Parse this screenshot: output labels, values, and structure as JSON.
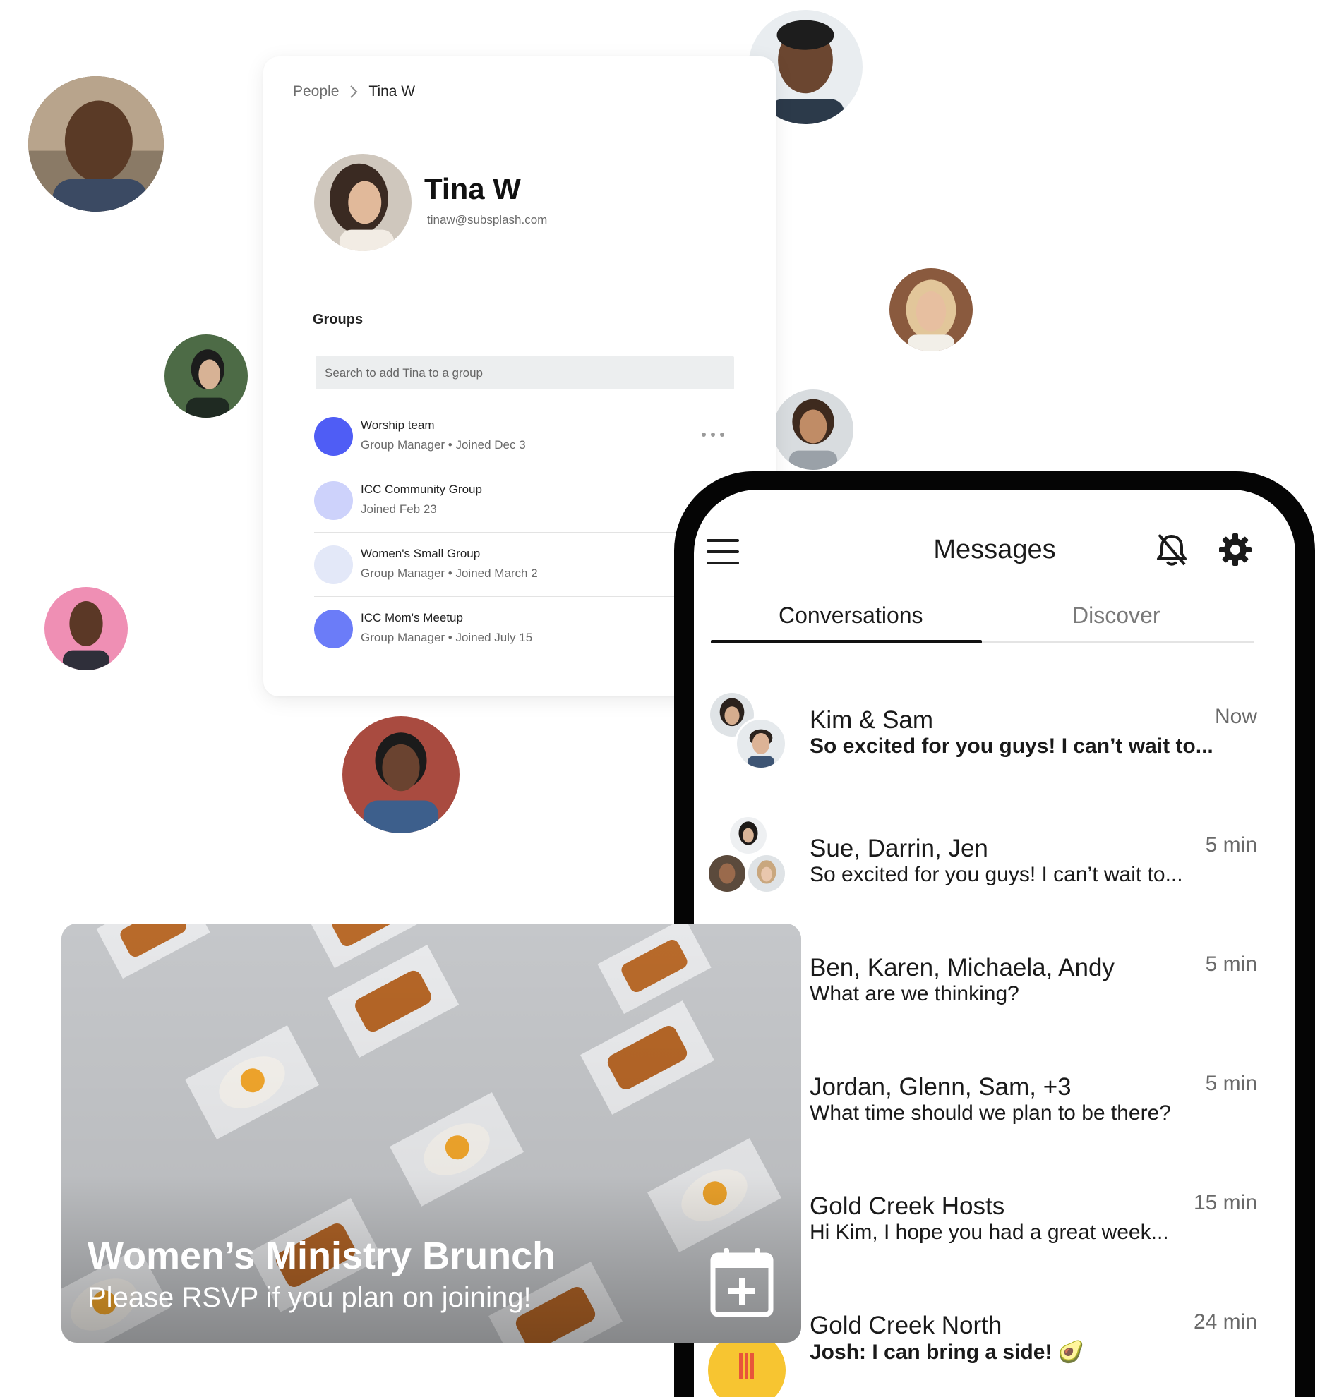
{
  "profile": {
    "breadcrumb": {
      "root": "People",
      "current": "Tina W"
    },
    "name": "Tina W",
    "email": "tinaw@subsplash.com",
    "groups_heading": "Groups",
    "search_placeholder": "Search to add Tina to a group",
    "groups": [
      {
        "name": "Worship team",
        "meta": "Group Manager • Joined Dec 3",
        "color": "#4f5df5"
      },
      {
        "name": "ICC Community Group",
        "meta": "Joined Feb 23",
        "color": "#cdd2fb"
      },
      {
        "name": "Women's Small Group",
        "meta": "Group Manager • Joined March 2",
        "color": "#e3e8f8"
      },
      {
        "name": "ICC Mom's Meetup",
        "meta": "Group Manager • Joined July 15",
        "color": "#6b7cf8"
      }
    ]
  },
  "messages": {
    "title": "Messages",
    "tabs": {
      "active": "Conversations",
      "inactive": "Discover"
    },
    "conversations": [
      {
        "name": "Kim & Sam",
        "time": "Now",
        "preview": "So excited for you guys! I can’t wait to...",
        "unread": true
      },
      {
        "name": "Sue, Darrin, Jen",
        "time": "5 min",
        "preview": "So excited for you guys! I can’t wait to...",
        "unread": false
      },
      {
        "name": "Ben, Karen, Michaela, Andy",
        "time": "5 min",
        "preview": "What are we thinking?",
        "unread": false
      },
      {
        "name": "Jordan, Glenn, Sam, +3",
        "time": "5 min",
        "preview": "What time should we plan to be there?",
        "unread": false
      },
      {
        "name": "Gold Creek Hosts",
        "time": "15 min",
        "preview": "Hi Kim, I hope you had a great week...",
        "unread": false
      },
      {
        "name": "Gold Creek North",
        "time": "24 min",
        "preview": "Josh: I can bring a side! 🥑",
        "unread": true
      }
    ]
  },
  "event": {
    "title": "Women’s Ministry Brunch",
    "subtitle": "Please RSVP if you plan on joining!"
  },
  "colors": {
    "accent_blue": "#4f5df5",
    "phone_frame": "#050505",
    "group_icon_yellow": "#f7c531"
  },
  "icons": [
    "chevron-right-icon",
    "ellipsis-icon",
    "menu-icon",
    "bell-off-icon",
    "gear-icon",
    "calendar-add-icon"
  ]
}
